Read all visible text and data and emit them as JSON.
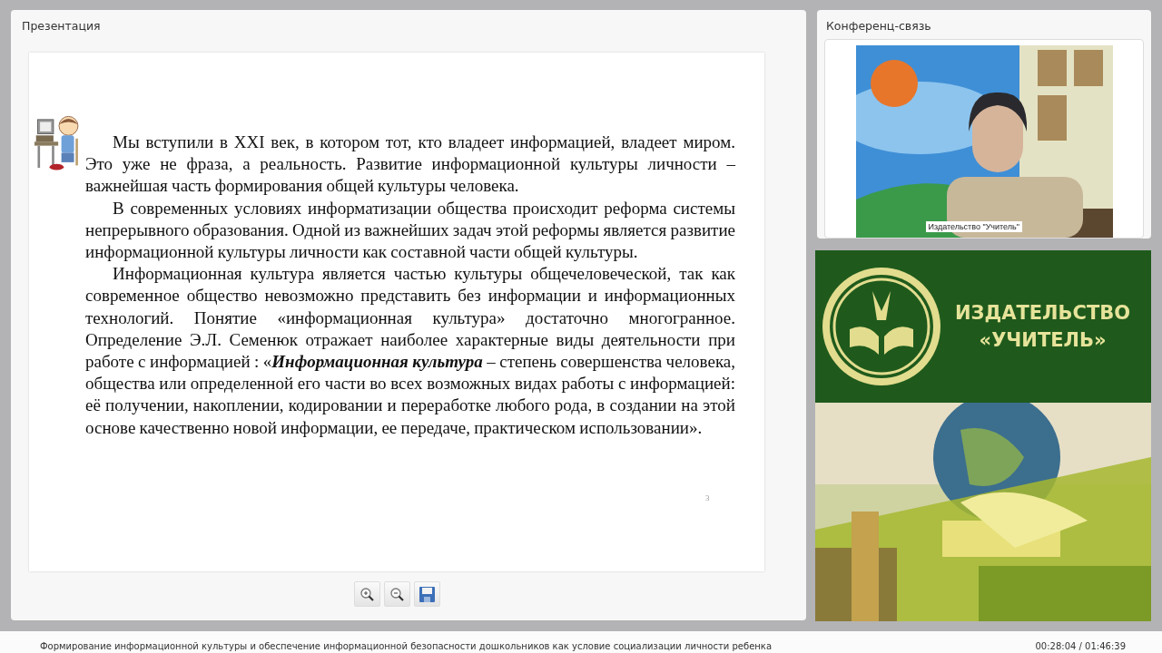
{
  "presentation": {
    "title": "Презентация",
    "slide": {
      "paragraphs": [
        "Мы вступили в XXI век, в котором тот, кто владеет информацией, владеет миром. Это уже не фраза, а реальность. Развитие информационной культуры личности – важнейшая часть формирования общей культуры человека.",
        "В современных условиях информатизации общества происходит реформа системы непрерывного образования. Одной из важнейших задач этой реформы является развитие информационной культуры личности как составной части общей культуры.",
        "Информационная культура является частью культуры общечеловеческой, так как современное общество невозможно представить без информации и информационных технологий. Понятие «информационная культура» достаточно многогранное. Определение Э.Л. Семенюк отражает наиболее характерные виды деятельности при работе с информацией : «**Информационная культура** – степень совершенства человека, общества или определенной его части во всех возможных видах работы с информацией: её получении, накоплении, кодировании и переработке любого рода, в создании на этой основе качественно новой информации, ее передаче, практическом использовании»."
      ],
      "page_number": "3"
    },
    "toolbar": [
      {
        "kind": "zoom-in"
      },
      {
        "kind": "zoom-out"
      },
      {
        "kind": "save"
      }
    ]
  },
  "conference": {
    "title": "Конференц-связь",
    "video": {
      "kind": "picture",
      "caption": "Издательство \"Учитель\""
    }
  },
  "publisher_banner": {
    "name_lines": [
      "ИЗДАТЕЛЬСТВО",
      "«УЧИТЕЛЬ»"
    ]
  },
  "status_bar": {
    "title": "Формирование информационной культуры и обеспечение информационной безопасности дошкольников как условие социализации личности ребенка",
    "time": "00:28:04 / 01:46:39"
  }
}
